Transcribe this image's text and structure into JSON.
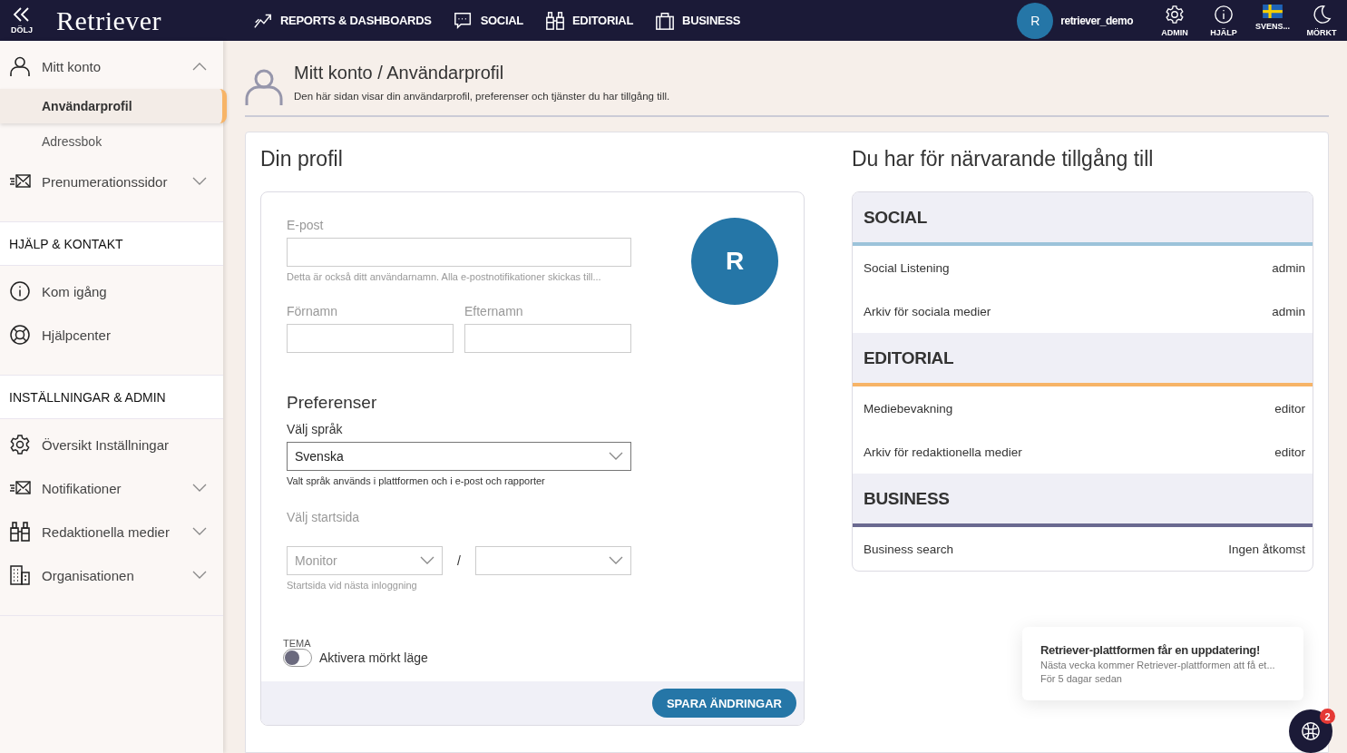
{
  "topbar": {
    "collapse_label": "DÖLJ",
    "logo": "Retriever",
    "nav": [
      {
        "label": "REPORTS & DASHBOARDS",
        "kind": "chart"
      },
      {
        "label": "SOCIAL",
        "kind": "chat"
      },
      {
        "label": "EDITORIAL",
        "kind": "binoculars"
      },
      {
        "label": "BUSINESS",
        "kind": "briefcase"
      }
    ],
    "user": {
      "initial": "R",
      "name": "retriever_demo"
    },
    "tools": [
      {
        "label": "ADMIN",
        "kind": "gear"
      },
      {
        "label": "HJÄLP",
        "kind": "info"
      },
      {
        "label": "SVENS...",
        "kind": "flag"
      },
      {
        "label": "MÖRKT",
        "kind": "moon"
      }
    ]
  },
  "sidebar": {
    "groups": [
      {
        "items": [
          {
            "label": "Mitt konto",
            "kind": "user",
            "expanded": true,
            "children": [
              {
                "label": "Användarprofil",
                "selected": true
              },
              {
                "label": "Adressbok",
                "selected": false
              }
            ]
          },
          {
            "label": "Prenumerationssidor",
            "kind": "mail",
            "expanded": false
          }
        ]
      },
      {
        "heading": "HJÄLP & KONTAKT",
        "items": [
          {
            "label": "Kom igång",
            "kind": "info"
          },
          {
            "label": "Hjälpcenter",
            "kind": "lifebuoy"
          }
        ]
      },
      {
        "heading": "INSTÄLLNINGAR & ADMIN",
        "items": [
          {
            "label": "Översikt Inställningar",
            "kind": "gear"
          },
          {
            "label": "Notifikationer",
            "kind": "mail",
            "expanded": false
          },
          {
            "label": "Redaktionella medier",
            "kind": "binoculars",
            "expanded": false
          },
          {
            "label": "Organisationen",
            "kind": "building",
            "expanded": false
          }
        ]
      }
    ]
  },
  "page_header": {
    "title": "Mitt konto / Användarprofil",
    "description": "Den här sidan visar din användarprofil, preferenser och tjänster du har tillgång till."
  },
  "profile": {
    "title": "Din profil",
    "avatar_initial": "R",
    "email": {
      "label": "E-post",
      "help": "Detta är också ditt användarnamn. Alla e-postnotifikationer skickas till..."
    },
    "first_name": {
      "label": "Förnamn"
    },
    "last_name": {
      "label": "Efternamn"
    },
    "preferences": {
      "title": "Preferenser",
      "language": {
        "label": "Välj språk",
        "value": "Svenska",
        "help": "Valt språk används i plattformen och i e-post och rapporter"
      },
      "start_page": {
        "label": "Välj startsida",
        "value": "Monitor",
        "separator": "/",
        "help": "Startsida vid nästa inloggning",
        "disabled": true
      }
    },
    "theme": {
      "label": "TEMA",
      "toggle_label": "Aktivera mörkt läge",
      "on": false
    },
    "save_button": "SPARA ÄNDRINGAR"
  },
  "access": {
    "title": "Du har för närvarande tillgång till",
    "sections": [
      {
        "name": "SOCIAL",
        "color": "#9cc3da",
        "rows": [
          {
            "service": "Social Listening",
            "role": "admin"
          },
          {
            "service": "Arkiv för sociala medier",
            "role": "admin"
          }
        ]
      },
      {
        "name": "EDITORIAL",
        "color": "#f7b467",
        "rows": [
          {
            "service": "Mediebevakning",
            "role": "editor"
          },
          {
            "service": "Arkiv för redaktionella medier",
            "role": "editor"
          }
        ]
      },
      {
        "name": "BUSINESS",
        "color": "#6a6990",
        "rows": [
          {
            "service": "Business search",
            "role": "Ingen åtkomst"
          }
        ]
      }
    ]
  },
  "notification": {
    "title": "Retriever-plattformen får en uppdatering!",
    "body": "Nästa vecka kommer Retriever-plattformen att få et...",
    "time": "För 5 dagar sedan"
  },
  "chat": {
    "badge": "2"
  }
}
